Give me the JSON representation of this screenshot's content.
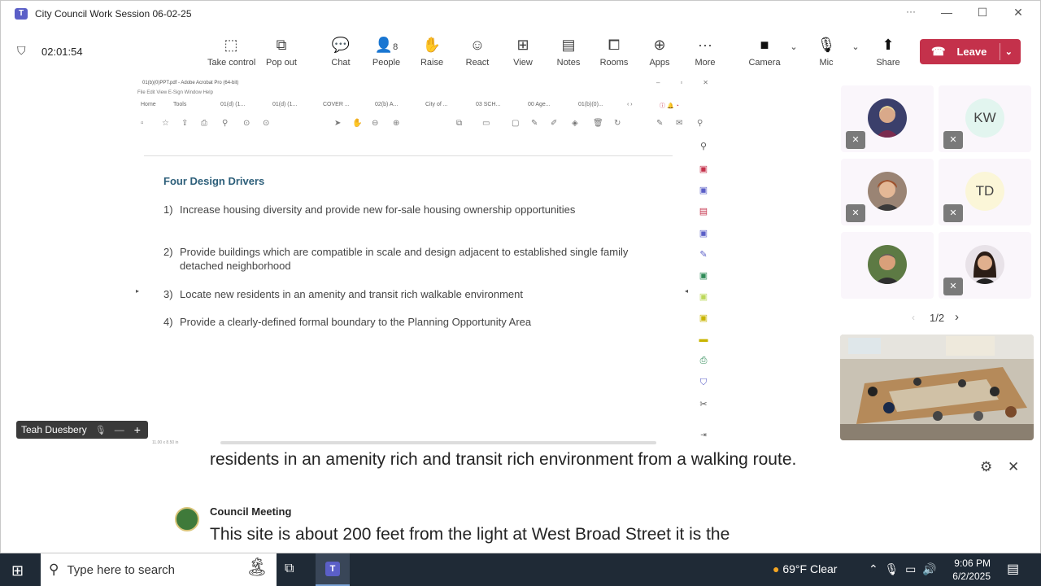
{
  "window": {
    "title": "City Council Work Session 06-02-25",
    "minimize": "—",
    "maximize": "☐",
    "close": "✕"
  },
  "meeting": {
    "timer": "02:01:54",
    "people_count": "8",
    "toolbar": [
      {
        "label": "Take control",
        "icon": "take-control-icon"
      },
      {
        "label": "Pop out",
        "icon": "pop-out-icon"
      },
      {
        "label": "Chat",
        "icon": "chat-icon"
      },
      {
        "label": "People",
        "icon": "people-icon"
      },
      {
        "label": "Raise",
        "icon": "raise-hand-icon"
      },
      {
        "label": "React",
        "icon": "react-icon"
      },
      {
        "label": "View",
        "icon": "view-icon"
      },
      {
        "label": "Notes",
        "icon": "notes-icon"
      },
      {
        "label": "Rooms",
        "icon": "rooms-icon"
      },
      {
        "label": "Apps",
        "icon": "apps-icon"
      },
      {
        "label": "More",
        "icon": "more-icon"
      },
      {
        "label": "Camera",
        "icon": "camera-icon"
      },
      {
        "label": "Mic",
        "icon": "mic-icon"
      },
      {
        "label": "Share",
        "icon": "share-icon"
      }
    ],
    "leave_label": "Leave",
    "leave_color": "#c4314b"
  },
  "shared_screen": {
    "acrobat_title": "01(b)(0)PPT.pdf - Adobe Acrobat Pro (64-bit)",
    "acrobat_menu": "File   Edit   View   E-Sign   Window   Help",
    "tabs": [
      "Home",
      "Tools",
      "01(d) (1...",
      "01(d) (1...",
      "COVER ...",
      "02(b) A...",
      "City of ...",
      "03 SCH...",
      "00 Age...",
      "01(b)(0)..."
    ],
    "heading": "Four Design Drivers",
    "items": [
      {
        "n": "1)",
        "text": "Increase housing diversity and provide new for-sale housing ownership opportunities"
      },
      {
        "n": "2)",
        "text": "Provide buildings which are compatible in scale and design adjacent to established single family detached neighborhood"
      },
      {
        "n": "3)",
        "text": "Locate new residents in an amenity and transit rich walkable environment"
      },
      {
        "n": "4)",
        "text": "Provide a clearly-defined formal boundary to the Planning Opportunity Area"
      }
    ],
    "page_size": "11.00 x 8.50 in",
    "presenter": "Teah Duesbery"
  },
  "participants": {
    "tiles": [
      {
        "initials": "",
        "type": "photo",
        "color": "#3b3f6b"
      },
      {
        "initials": "KW",
        "type": "initials",
        "color": "#e2f5ef"
      },
      {
        "initials": "",
        "type": "photo",
        "color": "#8a6a55"
      },
      {
        "initials": "TD",
        "type": "initials",
        "color": "#fbf6d8"
      },
      {
        "initials": "",
        "type": "photo",
        "color": "#4f6b3a"
      },
      {
        "initials": "",
        "type": "photo",
        "color": "#2b2b2b"
      }
    ],
    "pager": "1/2"
  },
  "captions": {
    "line1": "residents in an amenity rich and transit rich environment from a walking route.",
    "speaker": "Council Meeting",
    "line2": "This site is about 200 feet from the light at West Broad Street it is the"
  },
  "taskbar": {
    "search_placeholder": "Type here to search",
    "weather": "69°F  Clear",
    "time": "9:06 PM",
    "date": "6/2/2025"
  }
}
